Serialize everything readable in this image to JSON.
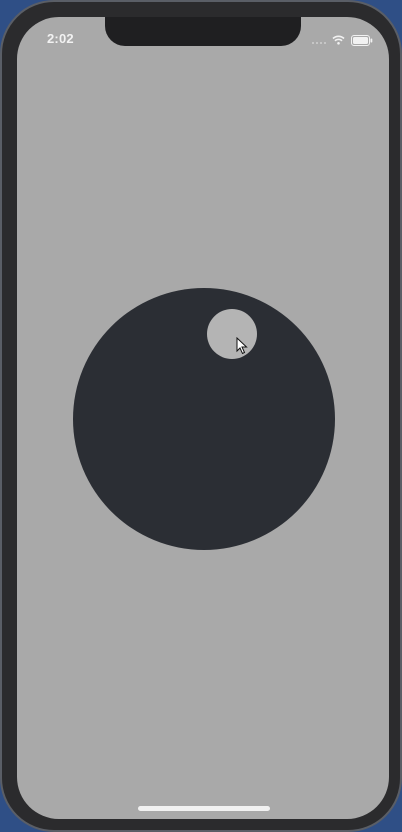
{
  "status_bar": {
    "time": "2:02",
    "icons": [
      "cellular-signal-icon",
      "wifi-icon",
      "battery-icon"
    ]
  },
  "canvas": {
    "background_color": "#a9a9a9",
    "large_circle_color": "#2b2e34",
    "small_circle_color": "#b4b4b4"
  },
  "home_indicator": {
    "color": "#f1f1f1"
  }
}
